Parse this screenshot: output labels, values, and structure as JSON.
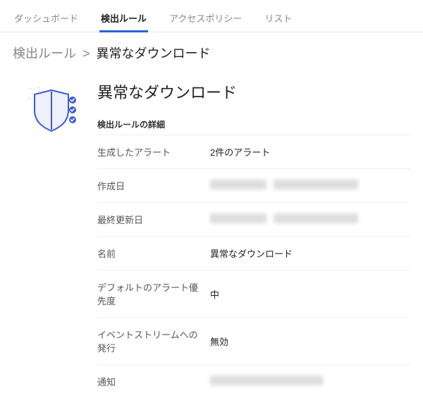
{
  "tabs": {
    "dashboard": "ダッシュボード",
    "rules": "検出ルール",
    "policies": "アクセスポリシー",
    "list": "リスト"
  },
  "breadcrumb": {
    "parent": "検出ルール",
    "sep": ">",
    "current": "異常なダウンロード"
  },
  "title": "異常なダウンロード",
  "section_label": "検出ルールの詳細",
  "rows": {
    "alerts": {
      "label": "生成したアラート",
      "value": "2件のアラート"
    },
    "created": {
      "label": "作成日",
      "value": ""
    },
    "updated": {
      "label": "最終更新日",
      "value": ""
    },
    "name": {
      "label": "名前",
      "value": "異常なダウンロード"
    },
    "priority": {
      "label": "デフォルトのアラート優先度",
      "value": "中"
    },
    "stream": {
      "label": "イベントストリームへの発行",
      "value": "無効"
    },
    "notify": {
      "label": "通知",
      "value": ""
    }
  }
}
